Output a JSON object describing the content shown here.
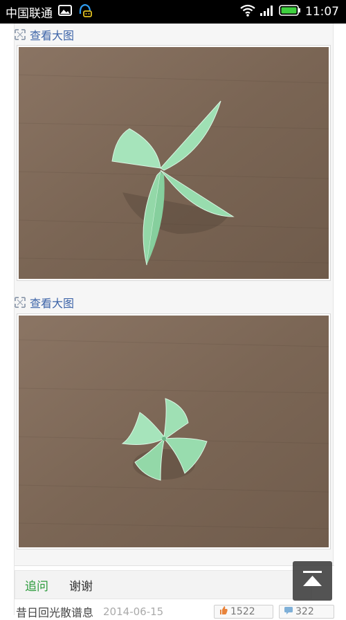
{
  "status_bar": {
    "carrier": "中国联通",
    "time": "11:07"
  },
  "images": [
    {
      "view_label": "查看大图",
      "description_icon": "expand-icon"
    },
    {
      "view_label": "查看大图",
      "description_icon": "expand-icon"
    }
  ],
  "reply": {
    "followup_label": "追问",
    "thanks_label": "谢谢",
    "author": "昔日回光散谱息",
    "date": "2014-06-15",
    "likes": "1522",
    "comments": "322"
  },
  "colors": {
    "link": "#3d64a8",
    "followup": "#2a9a3a",
    "leaf": "#9fe0b4",
    "table": "#7c6655"
  }
}
